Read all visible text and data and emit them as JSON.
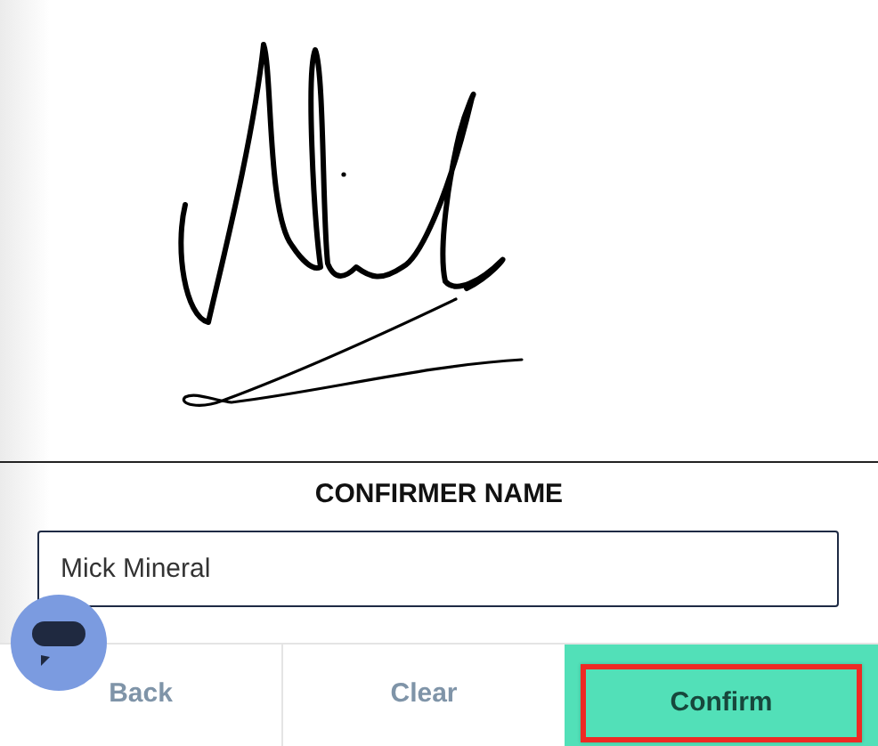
{
  "name_field": {
    "label": "CONFIRMER NAME",
    "value": "Mick Mineral"
  },
  "buttons": [
    {
      "label": "Back",
      "kind": "plain",
      "focused": false
    },
    {
      "label": "Clear",
      "kind": "plain",
      "focused": false
    },
    {
      "label": "Confirm",
      "kind": "primary",
      "focused": true
    }
  ]
}
